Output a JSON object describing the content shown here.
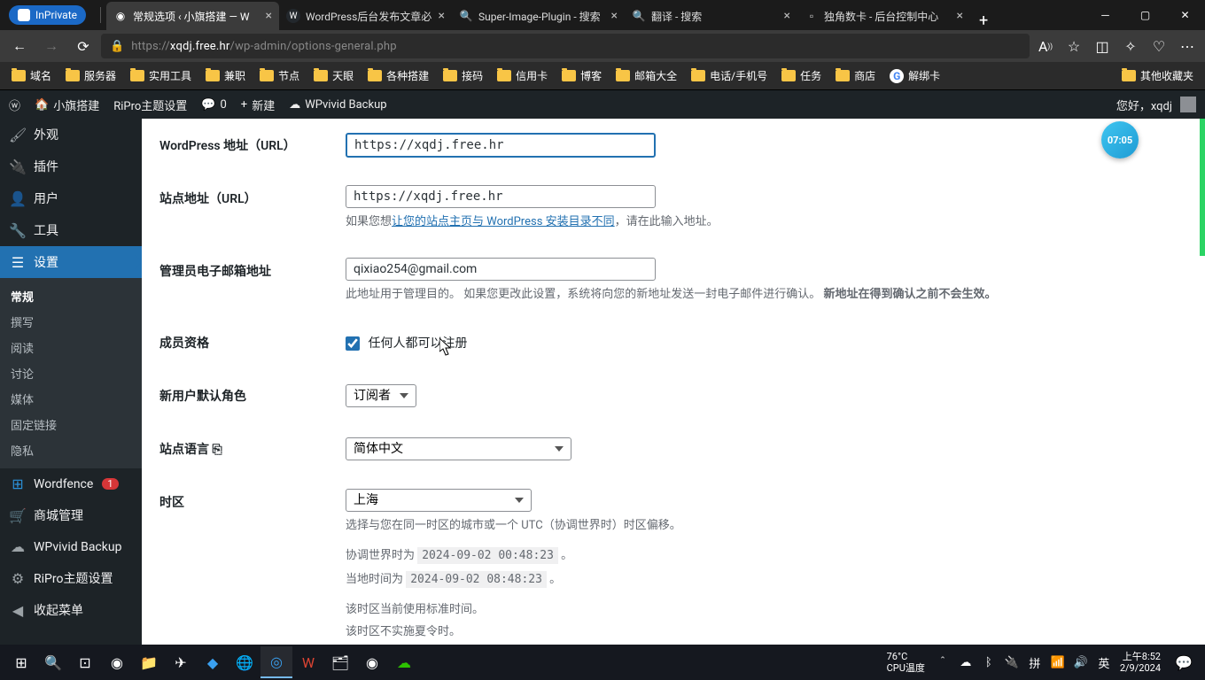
{
  "browser": {
    "inprivate": "InPrivate",
    "tabs": [
      {
        "title": "常规选项 ‹ 小旗搭建 — W",
        "active": true,
        "icon": "🔴"
      },
      {
        "title": "WordPress后台发布文章必",
        "active": false,
        "icon": "W"
      },
      {
        "title": "Super-Image-Plugin - 搜索",
        "active": false,
        "icon": "🔍"
      },
      {
        "title": "翻译 - 搜索",
        "active": false,
        "icon": "🔍"
      },
      {
        "title": "独角数卡 - 后台控制中心",
        "active": false,
        "icon": "□"
      }
    ],
    "url": "https://xqdj.free.hr/wp-admin/options-general.php",
    "bookmarks": [
      "域名",
      "服务器",
      "实用工具",
      "兼职",
      "节点",
      "天眼",
      "各种搭建",
      "接码",
      "信用卡",
      "博客",
      "邮箱大全",
      "电话/手机号",
      "任务",
      "商店"
    ],
    "bookmark_g": "解绑卡",
    "bookmark_other": "其他收藏夹"
  },
  "wp_adminbar": {
    "site": "小旗搭建",
    "ripro": "RiPro主题设置",
    "comments": "0",
    "new": "新建",
    "wpvivid": "WPvivid Backup",
    "howdy": "您好，xqdj"
  },
  "sidebar": {
    "items": [
      {
        "icon": "🖌",
        "label": "外观"
      },
      {
        "icon": "🔌",
        "label": "插件"
      },
      {
        "icon": "👤",
        "label": "用户"
      },
      {
        "icon": "🔧",
        "label": "工具"
      },
      {
        "icon": "⚙",
        "label": "设置",
        "current": true
      }
    ],
    "submenu": [
      "常规",
      "撰写",
      "阅读",
      "讨论",
      "媒体",
      "固定链接",
      "隐私"
    ],
    "submenu_current": "常规",
    "tail": [
      {
        "icon": "🛡",
        "label": "Wordfence",
        "badge": "1"
      },
      {
        "icon": "🛒",
        "label": "商城管理"
      },
      {
        "icon": "☁",
        "label": "WPvivid Backup"
      },
      {
        "icon": "⚙",
        "label": "RiPro主题设置"
      },
      {
        "icon": "◀",
        "label": "收起菜单"
      }
    ]
  },
  "form": {
    "wp_url_label": "WordPress 地址（URL）",
    "wp_url_value": "https://xqdj.free.hr",
    "site_url_label": "站点地址（URL）",
    "site_url_value": "https://xqdj.free.hr",
    "site_url_desc_a": "如果您想",
    "site_url_desc_link": "让您的站点主页与 WordPress 安装目录不同",
    "site_url_desc_b": "，请在此输入地址。",
    "admin_email_label": "管理员电子邮箱地址",
    "admin_email_value": "qixiao254@gmail.com",
    "admin_email_desc_a": "此地址用于管理目的。 如果您更改此设置，系统将向您的新地址发送一封电子邮件进行确认。 ",
    "admin_email_desc_b": "新地址在得到确认之前不会生效。",
    "membership_label": "成员资格",
    "membership_cb_label": "任何人都可以注册",
    "default_role_label": "新用户默认角色",
    "default_role_value": "订阅者",
    "site_lang_label": "站点语言",
    "site_lang_value": "简体中文",
    "tz_label": "时区",
    "tz_value": "上海",
    "tz_desc": "选择与您在同一时区的城市或一个 UTC（协调世界时）时区偏移。",
    "utc_label": "协调世界时为 ",
    "utc_value": "2024-09-02 00:48:23",
    "local_label": "当地时间为 ",
    "local_value": "2024-09-02 08:48:23",
    "tz_std": "该时区当前使用标准时间。",
    "tz_dst": "该时区不实施夏令时。"
  },
  "overlay_clock": "07:05",
  "taskbar": {
    "temp_value": "76°C",
    "temp_label": "CPU温度",
    "ime": "英",
    "time": "上午8:52",
    "date": "2/9/2024"
  }
}
